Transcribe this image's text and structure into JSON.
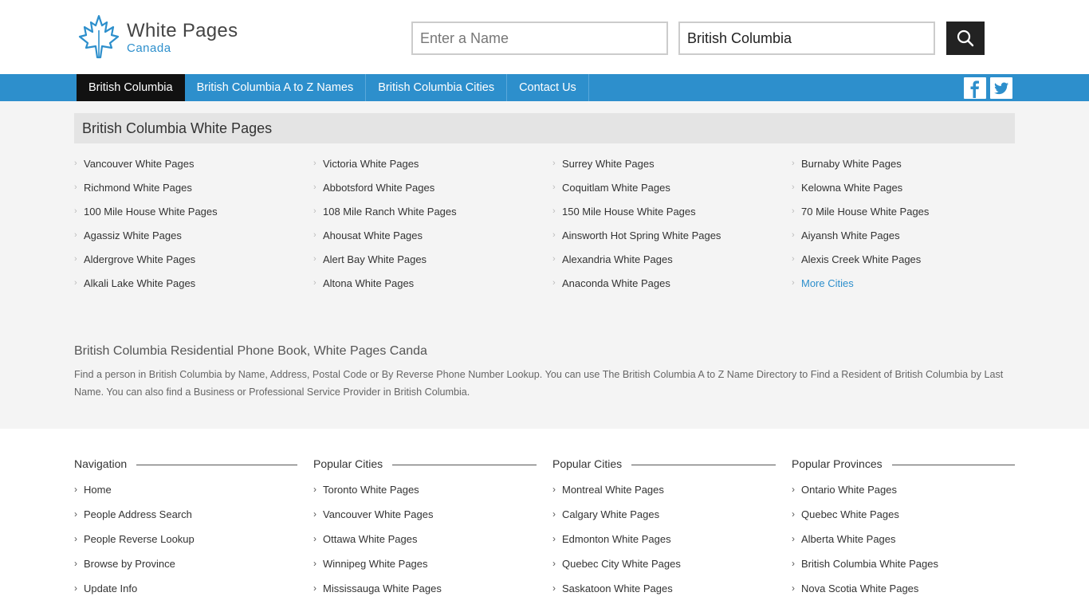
{
  "header": {
    "logo_title": "White Pages",
    "logo_subtitle": "Canada",
    "name_placeholder": "Enter a Name",
    "location_value": "British Columbia"
  },
  "nav": {
    "items": [
      {
        "label": "British Columbia",
        "active": true
      },
      {
        "label": "British Columbia A to Z Names",
        "active": false
      },
      {
        "label": "British Columbia Cities",
        "active": false
      },
      {
        "label": "Contact Us",
        "active": false
      }
    ],
    "social": [
      "facebook-icon",
      "twitter-icon"
    ]
  },
  "section": {
    "title": "British Columbia White Pages",
    "cities": [
      [
        "Vancouver White Pages",
        "Victoria White Pages",
        "Surrey White Pages",
        "Burnaby White Pages"
      ],
      [
        "Richmond White Pages",
        "Abbotsford White Pages",
        "Coquitlam White Pages",
        "Kelowna White Pages"
      ],
      [
        "100 Mile House White Pages",
        "108 Mile Ranch White Pages",
        "150 Mile House White Pages",
        "70 Mile House White Pages"
      ],
      [
        "Agassiz White Pages",
        "Ahousat White Pages",
        "Ainsworth Hot Spring White Pages",
        "Aiyansh White Pages"
      ],
      [
        "Aldergrove White Pages",
        "Alert Bay White Pages",
        "Alexandria White Pages",
        "Alexis Creek White Pages"
      ],
      [
        "Alkali Lake White Pages",
        "Altona White Pages",
        "Anaconda White Pages",
        "More Cities"
      ]
    ]
  },
  "about": {
    "title": "British Columbia Residential Phone Book, White Pages Canda",
    "text": "Find a person in British Columbia by Name, Address, Postal Code or By Reverse Phone Number Lookup. You can use The British Columbia A to Z Name Directory to Find a Resident of British Columbia by Last Name. You can also find a Business or Professional Service Provider in British Columbia."
  },
  "footer": {
    "columns": [
      {
        "heading": "Navigation",
        "links": [
          "Home",
          "People Address Search",
          "People Reverse Lookup",
          "Browse by Province",
          "Update Info"
        ]
      },
      {
        "heading": "Popular Cities",
        "links": [
          "Toronto White Pages",
          "Vancouver White Pages",
          "Ottawa White Pages",
          "Winnipeg White Pages",
          "Mississauga White Pages"
        ]
      },
      {
        "heading": "Popular Cities",
        "links": [
          "Montreal White Pages",
          "Calgary White Pages",
          "Edmonton White Pages",
          "Quebec City White Pages",
          "Saskatoon White Pages"
        ]
      },
      {
        "heading": "Popular Provinces",
        "links": [
          "Ontario White Pages",
          "Quebec White Pages",
          "Alberta White Pages",
          "British Columbia White Pages",
          "Nova Scotia White Pages"
        ]
      }
    ]
  },
  "colors": {
    "brand_blue": "#2d8fcc",
    "nav_active": "#111111",
    "main_bg": "#f4f4f4"
  }
}
